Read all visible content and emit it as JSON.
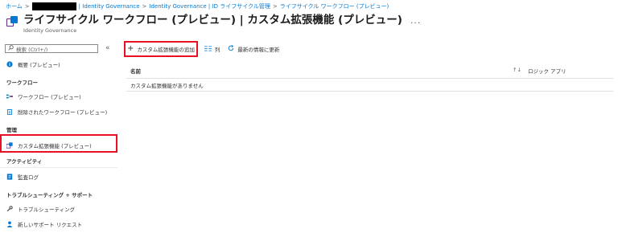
{
  "breadcrumb": {
    "items": [
      "ホーム",
      "| Identity Governance",
      "Identity Governance | ID ライフサイクル管理",
      "ライフサイクル ワークフロー (プレビュー)"
    ],
    "separator": ">"
  },
  "header": {
    "title": "ライフサイクル ワークフロー (プレビュー) | カスタム拡張機能 (プレビュー)",
    "subtitle": "Identity Governance",
    "more": "..."
  },
  "sidebar": {
    "search_placeholder": "検索 (Ctrl+/)",
    "collapse": "«",
    "items": [
      {
        "label": "概要 (プレビュー)",
        "icon": "info-icon"
      },
      {
        "section": "ワークフロー"
      },
      {
        "label": "ワークフロー (プレビュー)",
        "icon": "workflow-icon"
      },
      {
        "label": "削除されたワークフロー (プレビュー)",
        "icon": "trash-icon"
      },
      {
        "section": "管理"
      },
      {
        "label": "カスタム拡張機能 (プレビュー)",
        "icon": "extension-icon",
        "selected": true
      },
      {
        "section": "アクティビティ"
      },
      {
        "label": "監査ログ",
        "icon": "log-icon"
      },
      {
        "section": "トラブルシューティング + サポート"
      },
      {
        "label": "トラブルシューティング",
        "icon": "wrench-icon"
      },
      {
        "label": "新しいサポート リクエスト",
        "icon": "person-icon"
      }
    ]
  },
  "toolbar": {
    "add_label": "カスタム拡張機能の追加",
    "columns_label": "列",
    "refresh_label": "最新の情報に更新"
  },
  "grid": {
    "columns": [
      "名前",
      "ロジック アプリ"
    ],
    "sort_icon": "↑↓",
    "empty_message": "カスタム拡張機能がありません"
  },
  "colors": {
    "link": "#0078d4",
    "highlight": "#e81123",
    "accent": "#5c2d91"
  }
}
